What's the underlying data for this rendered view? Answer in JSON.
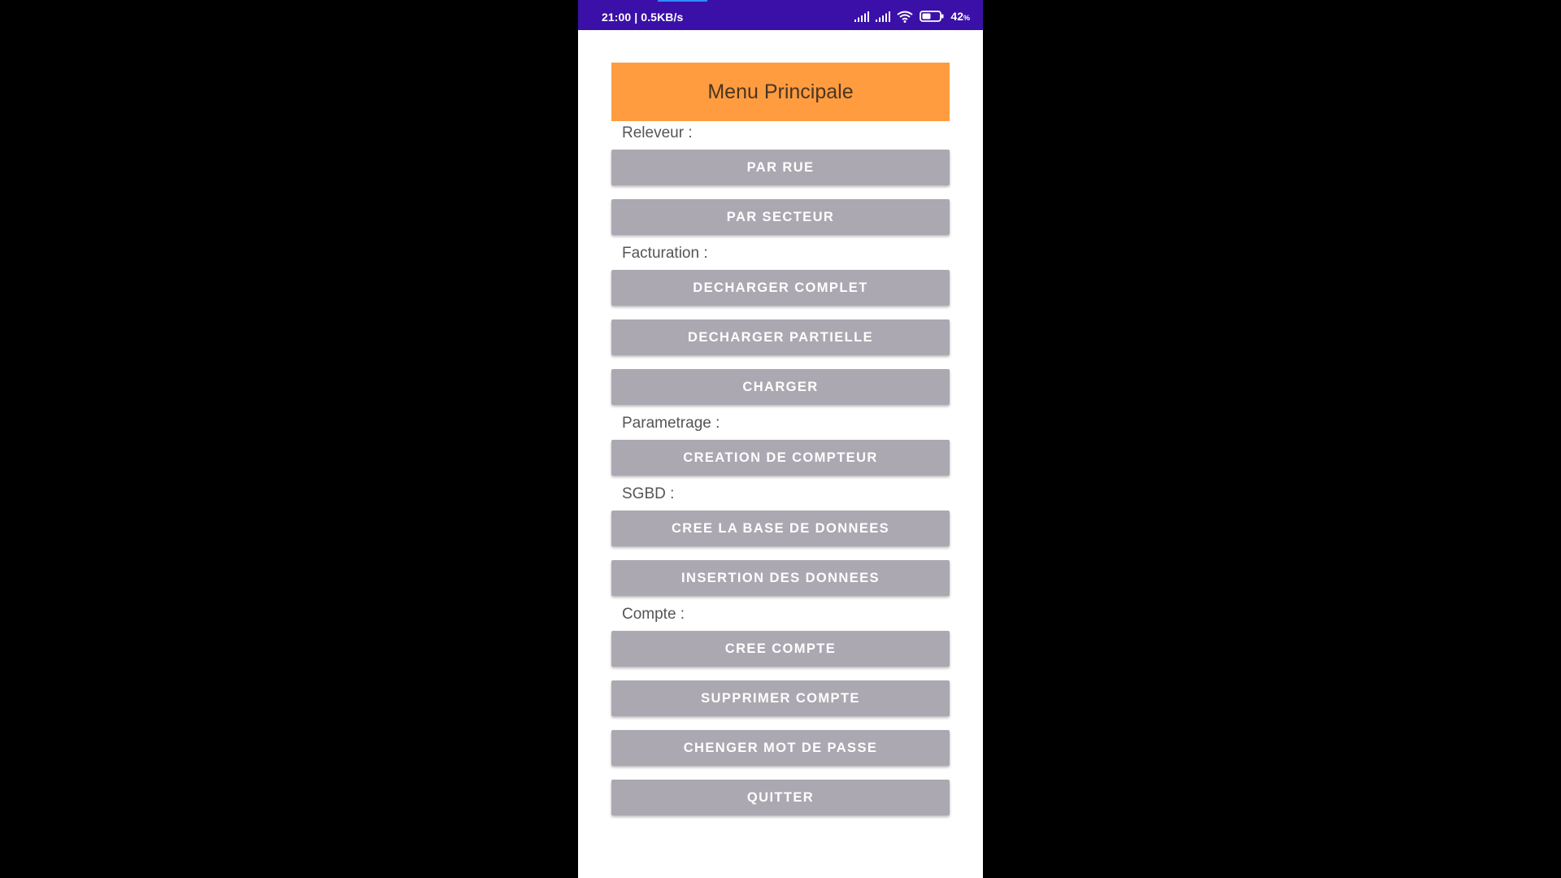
{
  "status_bar": {
    "time_speed": "21:00 | 0.5KB/s",
    "battery_level": "42",
    "battery_unit": "%",
    "icons": [
      "signal-icon",
      "signal-icon",
      "wifi-icon",
      "battery-icon"
    ],
    "background_color": "#3a10a8"
  },
  "header": {
    "title": "Menu Principale",
    "background_color": "#ff9c40"
  },
  "sections": {
    "releveur": {
      "label": "Releveur :",
      "buttons": [
        "PAR RUE",
        "PAR SECTEUR"
      ]
    },
    "facturation": {
      "label": "Facturation :",
      "buttons": [
        "DECHARGER COMPLET",
        "DECHARGER PARTIELLE",
        "CHARGER"
      ]
    },
    "parametrage": {
      "label": "Parametrage :",
      "buttons": [
        "CREATION DE COMPTEUR"
      ]
    },
    "sgbd": {
      "label": "SGBD :",
      "buttons": [
        "CREE LA BASE DE DONNEES",
        "INSERTION DES DONNEES"
      ]
    },
    "compte": {
      "label": "Compte :",
      "buttons": [
        "CREE COMPTE",
        "SUPPRIMER COMPTE",
        "CHENGER MOT DE PASSE",
        "QUITTER"
      ]
    }
  },
  "colors": {
    "button_background": "#aba8b1",
    "button_text": "#ffffff",
    "label_text": "#555555"
  }
}
